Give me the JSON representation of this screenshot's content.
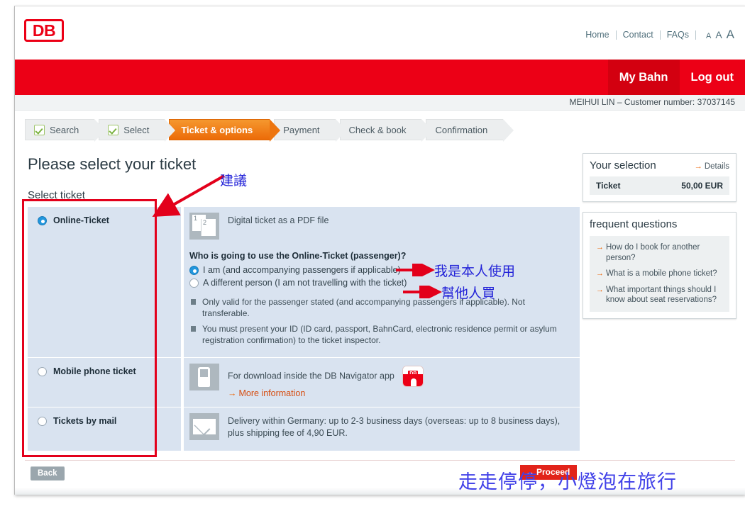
{
  "header": {
    "logo_text": "DB",
    "nav_links": [
      "Home",
      "Contact",
      "FAQs"
    ],
    "font_size_labels": [
      "A",
      "A",
      "A"
    ],
    "red_tabs": [
      {
        "label": "My Bahn",
        "active": true
      },
      {
        "label": "Log out",
        "active": false
      }
    ],
    "customer_strip": "MEIHUI LIN – Customer number: 37037145"
  },
  "steps": [
    {
      "label": "Search",
      "state": "done"
    },
    {
      "label": "Select",
      "state": "done"
    },
    {
      "label": "Ticket & options",
      "state": "current"
    },
    {
      "label": "Payment",
      "state": "todo"
    },
    {
      "label": "Check & book",
      "state": "todo"
    },
    {
      "label": "Confirmation",
      "state": "todo"
    }
  ],
  "main": {
    "page_title": "Please select your ticket",
    "section_title": "Select ticket",
    "options": [
      {
        "id": "online-ticket",
        "label": "Online-Ticket",
        "selected": true,
        "icon": "pdf-pages-icon",
        "description": "Digital ticket as a PDF file",
        "question": "Who is going to use the Online-Ticket (passenger)?",
        "passenger_choices": [
          {
            "label": "I am (and accompanying passengers if applicable)",
            "selected": true
          },
          {
            "label": "A different person (I am not travelling with the ticket)",
            "selected": false
          }
        ],
        "bullets": [
          "Only valid for the passenger stated (and accompanying passengers if applicable). Not transferable.",
          "You must present your ID (ID card, passport, BahnCard, electronic residence permit or asylum registration confirmation) to the ticket inspector."
        ]
      },
      {
        "id": "mobile-phone-ticket",
        "label": "Mobile phone ticket",
        "selected": false,
        "icon": "mobile-phone-icon",
        "description": "For download inside the DB Navigator app",
        "link_label": "More information",
        "badge": "DB"
      },
      {
        "id": "tickets-by-mail",
        "label": "Tickets by mail",
        "selected": false,
        "icon": "envelope-icon",
        "description": "Delivery within Germany: up to 2-3 business days (overseas: up to 8 business days), plus shipping fee of 4,90 EUR."
      }
    ]
  },
  "sidebar": {
    "selection": {
      "title": "Your selection",
      "details_label": "Details",
      "row_label": "Ticket",
      "row_value": "50,00 EUR"
    },
    "faq": {
      "title": "frequent questions",
      "items": [
        "How do I book for another person?",
        "What is a mobile phone ticket?",
        "What important things should I know about seat reservations?"
      ]
    }
  },
  "footer": {
    "back_label": "Back",
    "proceed_label": "Proceed"
  },
  "annotations": {
    "suggest_label": "建議",
    "self_use_label": "我是本人使用",
    "buy_for_other_label": "幫他人買",
    "watermark": "走走停停，小燈泡在旅行",
    "box_color": "#e3001b",
    "text_color": "#2323d8",
    "watermark_color": "#4141e8"
  }
}
